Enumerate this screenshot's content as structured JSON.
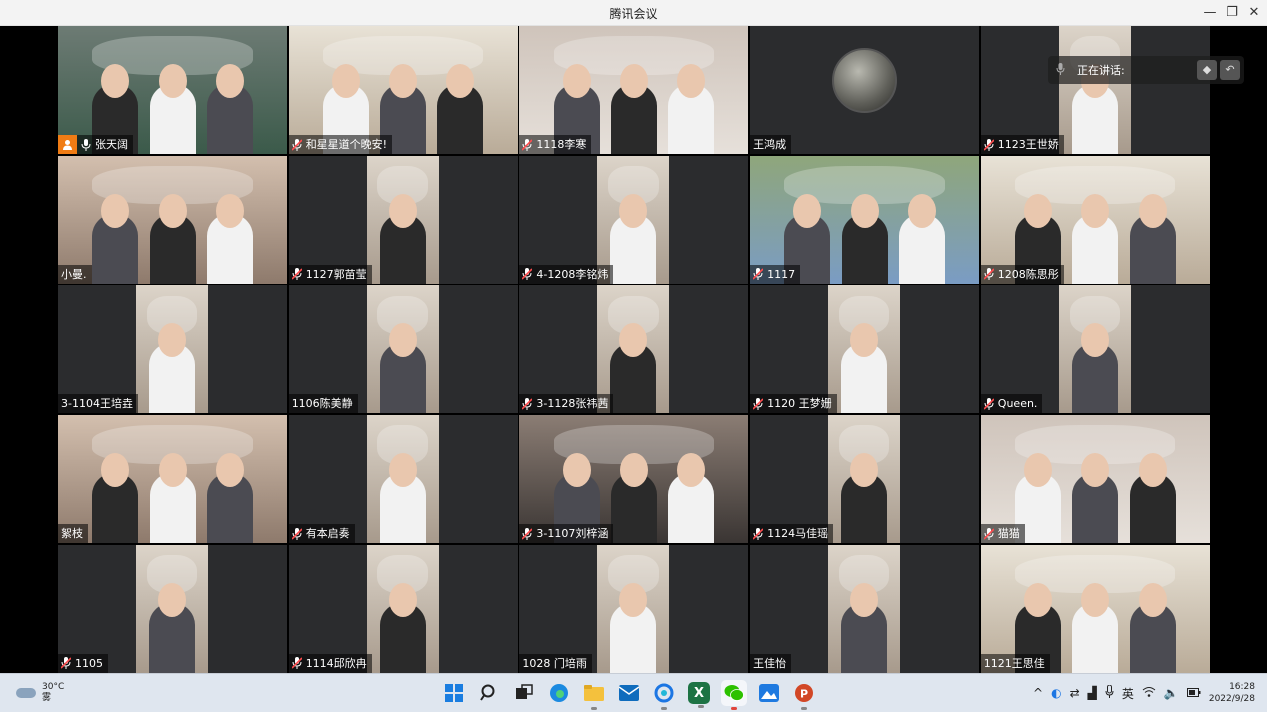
{
  "window": {
    "title": "腾讯会议",
    "min_icon": "minimize-icon",
    "max_icon": "maximize-icon",
    "close_icon": "close-icon"
  },
  "speaking_indicator": {
    "label": "正在讲话:"
  },
  "participants": [
    {
      "name": "张天阔",
      "host": true,
      "mic": "on",
      "video": "classroom"
    },
    {
      "name": "和星星道个晚安!",
      "mic": "muted",
      "video": "dorm"
    },
    {
      "name": "1118李寒",
      "mic": "muted",
      "video": "bright"
    },
    {
      "name": "王鸿成",
      "mic": "none",
      "video": "avatar"
    },
    {
      "name": "1123王世娇",
      "mic": "muted",
      "video": "narrow"
    },
    {
      "name": "小曼.",
      "mic": "none",
      "video": "warm"
    },
    {
      "name": "1127郭苗莹",
      "mic": "muted",
      "video": "narrow"
    },
    {
      "name": "4-1208李铭炜",
      "mic": "muted",
      "video": "narrow"
    },
    {
      "name": "1117",
      "mic": "muted",
      "video": "landscape"
    },
    {
      "name": "1208陈思彤",
      "mic": "muted",
      "video": "dorm"
    },
    {
      "name": "3-1104王培垚",
      "mic": "none",
      "video": "narrow"
    },
    {
      "name": "1106陈美静",
      "mic": "none",
      "video": "narrow"
    },
    {
      "name": "3-1128张祎茜",
      "mic": "muted",
      "video": "narrow"
    },
    {
      "name": "1120  王梦姗",
      "mic": "muted",
      "video": "narrow"
    },
    {
      "name": "Queen.",
      "mic": "muted",
      "video": "narrow"
    },
    {
      "name": "絮枝",
      "mic": "none",
      "video": "warm"
    },
    {
      "name": "有本启奏",
      "mic": "muted",
      "video": "narrow"
    },
    {
      "name": "3-1107刘梓涵",
      "mic": "muted",
      "video": "dark"
    },
    {
      "name": "1124马佳瑶",
      "mic": "muted",
      "video": "narrow"
    },
    {
      "name": "猫猫",
      "mic": "muted",
      "video": "bright"
    },
    {
      "name": "1105",
      "mic": "muted",
      "video": "narrow"
    },
    {
      "name": "1114邱欣冉",
      "mic": "muted",
      "video": "narrow"
    },
    {
      "name": "1028 门培雨",
      "mic": "none",
      "video": "narrow"
    },
    {
      "name": "王佳怡",
      "mic": "none",
      "video": "narrow"
    },
    {
      "name": "1121王思佳",
      "mic": "none",
      "video": "dorm"
    }
  ],
  "taskbar": {
    "weather": {
      "temp": "30°C",
      "condition": "雾"
    },
    "apps": [
      {
        "name": "windows-start",
        "icon": "windows-icon"
      },
      {
        "name": "search",
        "icon": "search-icon"
      },
      {
        "name": "task-view",
        "icon": "task-view-icon"
      },
      {
        "name": "edge",
        "icon": "edge-icon"
      },
      {
        "name": "file-explorer",
        "icon": "folder-icon"
      },
      {
        "name": "mail",
        "icon": "mail-icon"
      },
      {
        "name": "tencent-meeting",
        "icon": "meeting-icon"
      },
      {
        "name": "excel",
        "icon": "excel-icon"
      },
      {
        "name": "wechat",
        "icon": "wechat-icon"
      },
      {
        "name": "photos",
        "icon": "photos-icon"
      },
      {
        "name": "powerpoint",
        "icon": "powerpoint-icon"
      }
    ],
    "ime": "英",
    "time": "16:28",
    "date": "2022/9/28"
  },
  "colors": {
    "tile_bg": "#2b2c2e",
    "host_badge": "#f07c14",
    "muted_mic": "#ff4d4f",
    "taskbar_bg": "#dfe6ef"
  }
}
